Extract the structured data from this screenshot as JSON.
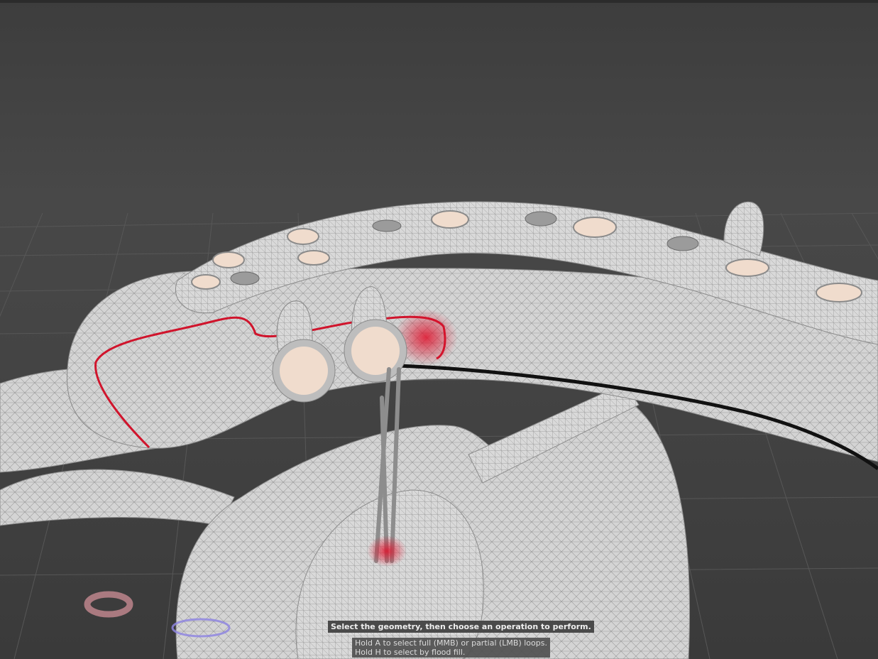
{
  "viewport": {
    "name": "3D viewport",
    "background_color": "#3b3b3b",
    "grid_color": "#555555",
    "mesh_color": "#d2d2d2",
    "highlight_color": "#d0142c",
    "screw_head_color": "#f0dccd"
  },
  "status": {
    "primary": "Select the geometry, then choose an operation to perform.",
    "secondary_lines": [
      "Hold A to select full (MMB) or partial (LMB) loops.",
      "Hold H to select by flood fill."
    ]
  },
  "handles": {
    "axis_handle_icon": "rotate-handle-icon",
    "ring_handle_icon": "transform-ring-icon"
  }
}
